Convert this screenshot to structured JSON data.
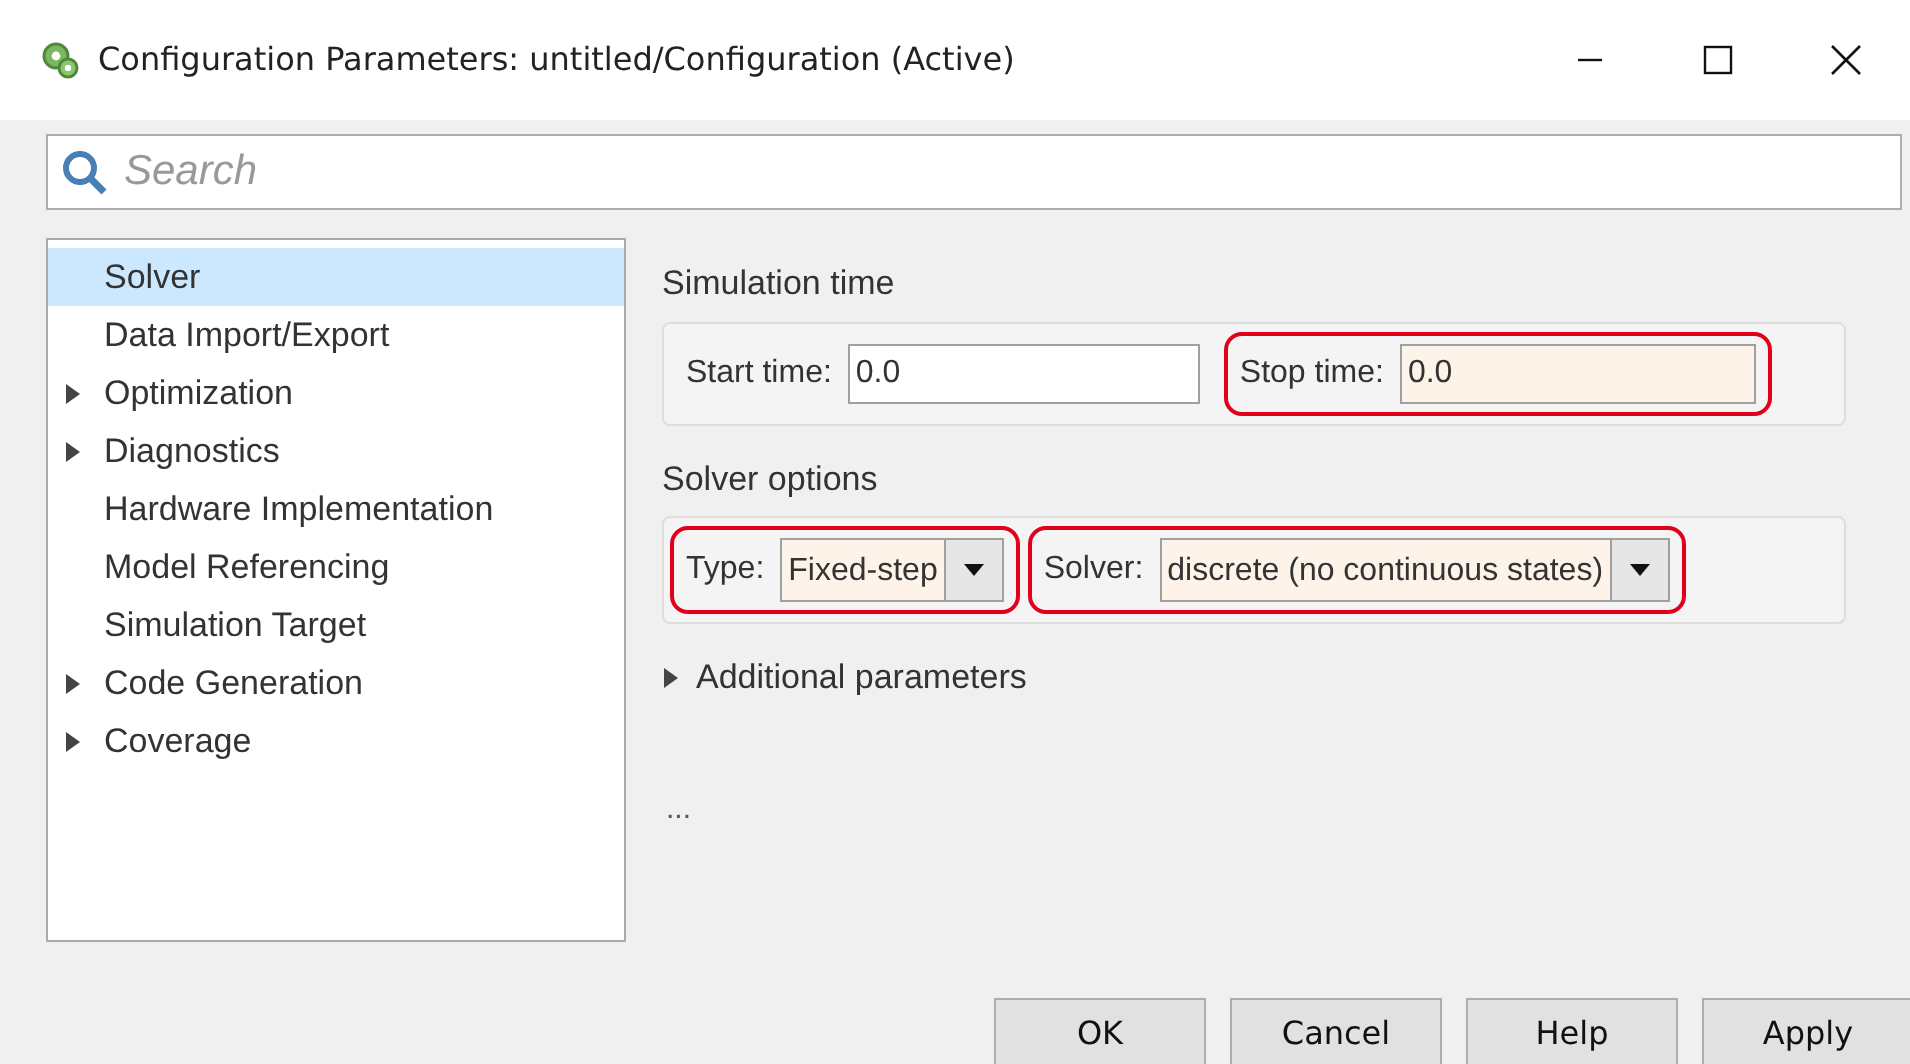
{
  "window": {
    "title": "Configuration Parameters: untitled/Configuration (Active)"
  },
  "search": {
    "placeholder": "Search"
  },
  "sidebar": {
    "items": [
      {
        "label": "Solver",
        "expandable": false,
        "selected": true
      },
      {
        "label": "Data Import/Export",
        "expandable": false,
        "selected": false
      },
      {
        "label": "Optimization",
        "expandable": true,
        "selected": false
      },
      {
        "label": "Diagnostics",
        "expandable": true,
        "selected": false
      },
      {
        "label": "Hardware Implementation",
        "expandable": false,
        "selected": false
      },
      {
        "label": "Model Referencing",
        "expandable": false,
        "selected": false
      },
      {
        "label": "Simulation Target",
        "expandable": false,
        "selected": false
      },
      {
        "label": "Code Generation",
        "expandable": true,
        "selected": false
      },
      {
        "label": "Coverage",
        "expandable": true,
        "selected": false
      }
    ]
  },
  "sections": [
    {
      "title": "Simulation time",
      "fields": [
        {
          "kind": "text",
          "label": "Start time:",
          "value": "0.0",
          "changed": false,
          "highlighted": false
        },
        {
          "kind": "text",
          "label": "Stop time:",
          "value": "0.0",
          "changed": true,
          "highlighted": true
        }
      ]
    },
    {
      "title": "Solver options",
      "fields": [
        {
          "kind": "select",
          "label": "Type:",
          "value": "Fixed-step",
          "changed": true,
          "highlighted": true
        },
        {
          "kind": "select",
          "label": "Solver:",
          "value": "discrete (no continuous states)",
          "changed": true,
          "highlighted": true
        }
      ]
    }
  ],
  "additional": {
    "label": "Additional parameters",
    "expanded": false
  },
  "ellipsis": "...",
  "buttons": [
    "OK",
    "Cancel",
    "Help",
    "Apply"
  ]
}
